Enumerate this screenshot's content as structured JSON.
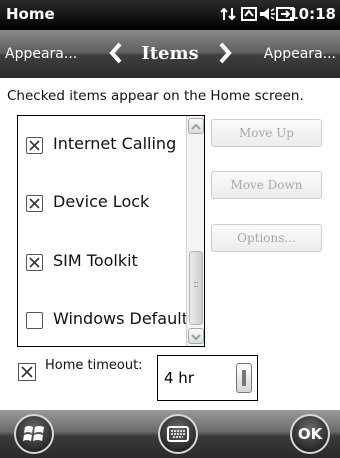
{
  "status_bar": {
    "title": "Home",
    "time": "10:18",
    "icons": [
      "data-connection-icon",
      "message-icon",
      "speaker-icon",
      "battery-charging-icon"
    ]
  },
  "nav": {
    "prev_label": "Appeara...",
    "title": "Items",
    "next_label": "Appeara..."
  },
  "instructions": "Checked items appear on the Home screen.",
  "items": [
    {
      "label": "Internet Calling",
      "checked": true
    },
    {
      "label": "Device Lock",
      "checked": true
    },
    {
      "label": "SIM Toolkit",
      "checked": true
    },
    {
      "label": "Windows Default",
      "checked": false
    }
  ],
  "buttons": {
    "move_up": "Move Up",
    "move_down": "Move Down",
    "options": "Options..."
  },
  "timeout": {
    "label": "Home timeout:",
    "checked": true,
    "value": "4 hr"
  },
  "bottom_bar": {
    "ok_label": "OK"
  }
}
